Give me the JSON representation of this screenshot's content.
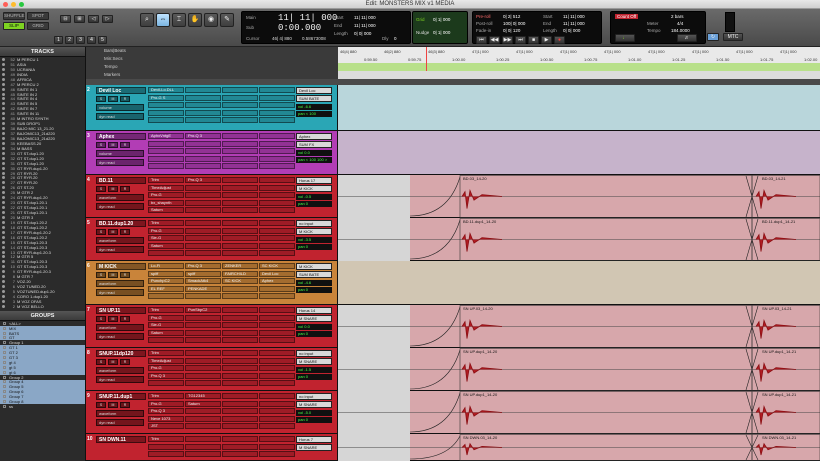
{
  "window": {
    "title": "Edit: MONSTERS MIX v1 MEDIA",
    "lights": [
      "#ff5f57",
      "#febc2e",
      "#28c840"
    ]
  },
  "toolbar": {
    "modes": [
      "SHUFFLE",
      "SPOT",
      "SLIP",
      "GRID"
    ],
    "presets": [
      "1",
      "2",
      "3",
      "4",
      "5"
    ],
    "tools": [
      {
        "icon": "zoom-icon",
        "glyph": "⌕",
        "on": false
      },
      {
        "icon": "trim-icon",
        "glyph": "⇔",
        "on": true
      },
      {
        "icon": "selector-icon",
        "glyph": "⌶",
        "on": false
      },
      {
        "icon": "grabber-icon",
        "glyph": "✋",
        "on": false
      },
      {
        "icon": "scrubber-icon",
        "glyph": "◉",
        "on": false
      },
      {
        "icon": "pencil-icon",
        "glyph": "✎",
        "on": false
      }
    ],
    "counter": {
      "main_label": "Main",
      "main": "11| 11| 000",
      "sub_label": "Sub",
      "sub": "0:00.000",
      "start_label": "Start",
      "start": "11| 11| 000",
      "end_label": "End",
      "end": "11| 11| 000",
      "length_label": "Length",
      "length": "0| 0| 000",
      "cursor_label": "Cursor",
      "cursor": "46| 4| 880",
      "sample": "0.58673008",
      "dly_label": "Dly",
      "dly": "0"
    },
    "grid": {
      "grid_label": "Grid",
      "grid_val": "0| 1| 000",
      "nudge_label": "Nudge",
      "nudge_val": "0| 1| 000"
    },
    "preroll": {
      "pre_label": "Pre-roll",
      "pre": "0| 2| 512",
      "post_label": "Post-roll",
      "post": "100| 0| 000",
      "fade_label": "Fade-in",
      "fade": "0| 0| 120"
    },
    "selection": {
      "start_label": "Start",
      "start": "11| 11| 000",
      "end_label": "End",
      "end": "11| 11| 000",
      "len_label": "Length",
      "len": "0| 0| 000"
    },
    "meter": {
      "count_off": "Count Off",
      "bars": "2 bars",
      "meter_label": "Meter",
      "meter": "4/4",
      "tempo_label": "Tempo",
      "tempo": "184.0000"
    },
    "transport_glyphs": [
      "⏮",
      "◀◀",
      "▶▶",
      "⏭",
      "■",
      "▶",
      "●"
    ],
    "mtc": "MTC"
  },
  "tracks_panel": {
    "header": "TRACKS",
    "items": [
      {
        "n": "52",
        "name": "M PERCU 1"
      },
      {
        "n": "51",
        "name": "ASIA"
      },
      {
        "n": "50",
        "name": "UCRANIA"
      },
      {
        "n": "49",
        "name": "INDIA"
      },
      {
        "n": "48",
        "name": "AFRICA"
      },
      {
        "n": "47",
        "name": "M PERCU 2"
      },
      {
        "n": "46",
        "name": "SINTE IN 1"
      },
      {
        "n": "45",
        "name": "SINTE IN 2"
      },
      {
        "n": "44",
        "name": "SINTE IN 4"
      },
      {
        "n": "43",
        "name": "SINTE IN 5"
      },
      {
        "n": "42",
        "name": "SINTE IN 7"
      },
      {
        "n": "41",
        "name": "SINTE IN 11"
      },
      {
        "n": "40",
        "name": "M INTRO SYNTH"
      },
      {
        "n": "39",
        "name": "SUB DROP1"
      },
      {
        "n": "38",
        "name": "BAJO MIC 13_21.20"
      },
      {
        "n": "37",
        "name": "BAJOMIC13_21d220"
      },
      {
        "n": "36",
        "name": "BAJOMIC13_21d220"
      },
      {
        "n": "35",
        "name": "KEEBASS.20"
      },
      {
        "n": "34",
        "name": "M BASS"
      },
      {
        "n": "33",
        "name": "GT ST.dup1.20"
      },
      {
        "n": "32",
        "name": "GT ST.dup1.20"
      },
      {
        "n": "31",
        "name": "GT ST.dup1.20"
      },
      {
        "n": "30",
        "name": "GT RYR.dup1.20"
      },
      {
        "n": "29",
        "name": "GT RYR.20"
      },
      {
        "n": "28",
        "name": "GT RYR.20"
      },
      {
        "n": "27",
        "name": "GT RYR.20"
      },
      {
        "n": "26",
        "name": "GT ST.20"
      },
      {
        "n": "25",
        "name": "M GTR 2"
      },
      {
        "n": "24",
        "name": "GT RYR.dup1.20"
      },
      {
        "n": "23",
        "name": "GT ST.dup1.20.1"
      },
      {
        "n": "22",
        "name": "GT ST.dup1.20.1"
      },
      {
        "n": "21",
        "name": "GT ST.dup1.20.1"
      },
      {
        "n": "20",
        "name": "M GTR 3"
      },
      {
        "n": "19",
        "name": "GT ST.dup1.20.2"
      },
      {
        "n": "18",
        "name": "GT ST.dup1.20.2"
      },
      {
        "n": "17",
        "name": "GT RYR.dup1.20.2"
      },
      {
        "n": "16",
        "name": "GT ST.dup1.20.2"
      },
      {
        "n": "15",
        "name": "GT ST.dup1.20.3"
      },
      {
        "n": "14",
        "name": "GT ST.dup1.20.3"
      },
      {
        "n": "13",
        "name": "GT RYR.dup1.20.3"
      },
      {
        "n": "12",
        "name": "M GTR 5"
      },
      {
        "n": "11",
        "name": "GT ST.dup1.20.3"
      },
      {
        "n": "10",
        "name": "GT ST.dup1.20.3"
      },
      {
        "n": "9",
        "name": "GT RYR.dup1.20.3"
      },
      {
        "n": "8",
        "name": "M GTR 7"
      },
      {
        "n": "7",
        "name": "VOZ.20"
      },
      {
        "n": "6",
        "name": "VOZ TUNED.20"
      },
      {
        "n": "5",
        "name": "VOZTUNED.dup1.20"
      },
      {
        "n": "4",
        "name": "CORO 1.dup1.20"
      },
      {
        "n": "3",
        "name": "M VOZ OFAS"
      },
      {
        "n": "2",
        "name": "M VOZ BELLO"
      }
    ]
  },
  "groups_panel": {
    "header": "GROUPS",
    "items": [
      {
        "name": "<ALL>",
        "sel": false
      },
      {
        "name": "MIX",
        "sel": true
      },
      {
        "name": "BATS",
        "sel": true
      },
      {
        "name": "GT",
        "sel": true
      },
      {
        "name": "Group 1",
        "sel": false
      },
      {
        "name": "GT 1",
        "sel": true
      },
      {
        "name": "GT 2",
        "sel": true
      },
      {
        "name": "GT 3",
        "sel": true
      },
      {
        "name": "gt 4",
        "sel": true
      },
      {
        "name": "gt 5",
        "sel": true
      },
      {
        "name": "gt 6",
        "sel": true
      },
      {
        "name": "Group 2",
        "sel": false
      },
      {
        "name": "Group 4",
        "sel": true
      },
      {
        "name": "Group 5",
        "sel": true
      },
      {
        "name": "Group 6",
        "sel": true
      },
      {
        "name": "Group 7",
        "sel": true
      },
      {
        "name": "Group 8",
        "sel": true
      },
      {
        "name": "ss",
        "sel": false
      }
    ]
  },
  "columns": {
    "ruler_name": "Bars|Beats",
    "inserts_ae": "INSERTS A-E",
    "inserts_fj": "INSERTS F-J",
    "sends_ae": "SENDS A-E",
    "sends_fj": "SENDS F-J",
    "io": "I / O",
    "rows": [
      "Min:Secs",
      "Tempo",
      "Markers"
    ],
    "bars": [
      "46|4| 880",
      "46|2| 880",
      "46|3| 880",
      "47|1| 000",
      "47|1| 000",
      "47|1| 000",
      "47|1| 000",
      "47|1| 000",
      "47|1| 000",
      "47|1| 000",
      "47|1| 000"
    ],
    "times": [
      "0:59.50",
      "0:59.75",
      "1:00.00",
      "1:00.25",
      "1:00.50",
      "1:00.75",
      "1:01.00",
      "1:01.25",
      "1:01.50",
      "1:01.75",
      "1:02.00"
    ]
  },
  "tracks": [
    {
      "num": "2",
      "name": "Devil Loc",
      "color": "#2aa6b5",
      "lane": "#b9d6db",
      "height": 46,
      "view": "volume",
      "inserts": [
        "Devil-Lo.DLL",
        "Pro-G S"
      ],
      "inserts_fj": [],
      "sends": [],
      "sends_fj": [],
      "io": [
        "Devil Loc",
        "SUM BATE"
      ],
      "vol": "-6.6",
      "pan": "< 100",
      "clips": []
    },
    {
      "num": "3",
      "name": "Aphex",
      "color": "#b23db5",
      "lane": "#c6b3cb",
      "height": 44,
      "view": "volume",
      "inserts": [
        "AphxVntgE"
      ],
      "inserts_fj": [
        "Pro-Q 3"
      ],
      "sends": [],
      "sends_fj": [],
      "io": [
        "Aphex",
        "SUM FX"
      ],
      "vol": "0.0",
      "pan": "< 100  100 >",
      "clips": []
    },
    {
      "num": "4",
      "name": "BD.11",
      "color": "#c1232f",
      "lane": "#d7a7ab",
      "height": 43,
      "view": "waveform",
      "inserts": [
        "Trim",
        "TimeAdjust",
        "Pro-G",
        "bx_shaynth",
        "Saturn"
      ],
      "inserts_fj": [
        "Pro-Q 3"
      ],
      "sends": [],
      "sends_fj": [],
      "io": [
        "Horus 17",
        "M KICK"
      ],
      "vol": "-0.5",
      "pan": "0",
      "clips": [
        "BD.03_14-20",
        "BD.03_14-21"
      ]
    },
    {
      "num": "5",
      "name": "BD.11.dup1.20",
      "color": "#c1232f",
      "lane": "#d7a7ab",
      "height": 43,
      "view": "waveform",
      "inserts": [
        "Trim",
        "Pro-G",
        "Sie-G",
        "Saturn"
      ],
      "inserts_fj": [],
      "sends": [],
      "sends_fj": [],
      "io": [
        "no input",
        "M KICK"
      ],
      "vol": "-3.5",
      "pan": "0",
      "clips": [
        "BD.11.dup1_14-20",
        "BD.11.dup1_14-21"
      ]
    },
    {
      "num": "6",
      "name": "M KICK",
      "color": "#c9843a",
      "lane": "#d1c6b3",
      "height": 44,
      "view": "waveform",
      "inserts": [
        "Lo-Fi",
        "spiff",
        "PunchpC2",
        "EL REF"
      ],
      "inserts_fj": [
        "Pro-Q 3",
        "spiff",
        "SmackAtk4",
        "PENKADE"
      ],
      "sends": [
        "ZENKER",
        "FAIRCHILD",
        "SC KICK"
      ],
      "sends_fj": [
        "SC KICK",
        "Devil Loc",
        "Aphex"
      ],
      "io": [
        "M KICK",
        "SUM BATE"
      ],
      "vol": "-4.6",
      "pan": "0",
      "clips": []
    },
    {
      "num": "7",
      "name": "SN UP.11",
      "color": "#c1232f",
      "lane": "#d7a7ab",
      "height": 43,
      "view": "waveform",
      "inserts": [
        "Trim",
        "Pro-G",
        "Sie-G",
        "Saturn"
      ],
      "inserts_fj": [
        "PunSbpC2"
      ],
      "sends": [],
      "sends_fj": [],
      "io": [
        "Horus 14",
        "M SNARE"
      ],
      "vol": "0.0",
      "pan": "0",
      "clips": [
        "SN UP.03_14-20",
        "SN UP.03_14-21"
      ]
    },
    {
      "num": "8",
      "name": "SNUP.11dp120",
      "color": "#c1232f",
      "lane": "#d7a7ab",
      "height": 43,
      "view": "waveform",
      "inserts": [
        "Trim",
        "TimeAdjust",
        "Pro-G",
        "Pro-Q 3"
      ],
      "inserts_fj": [],
      "sends": [],
      "sends_fj": [],
      "io": [
        "no input",
        "M SNARE"
      ],
      "vol": "-1.5",
      "pan": "0",
      "clips": [
        "SN UP.dup1_14-20",
        "SN UP.dup1_14-21"
      ]
    },
    {
      "num": "9",
      "name": "SNUP.11.dup1",
      "color": "#c1232f",
      "lane": "#d7a7ab",
      "height": 43,
      "view": "waveform",
      "inserts": [
        "Trim",
        "Pro-G",
        "Pro-Q 3",
        "Neve 1073",
        "JST"
      ],
      "inserts_fj": [
        "TG12345",
        "Saturn"
      ],
      "sends": [],
      "sends_fj": [],
      "io": [
        "no input",
        "M SNARE"
      ],
      "vol": "-5.0",
      "pan": "0",
      "clips": [
        "SN UP.dup1_14-20",
        "SN UP.dup1_14-21"
      ]
    },
    {
      "num": "10",
      "name": "SN DWN.11",
      "color": "#c1232f",
      "lane": "#d7a7ab",
      "height": 27,
      "view": "waveform",
      "inserts": [
        "Trim"
      ],
      "inserts_fj": [],
      "sends": [],
      "sends_fj": [],
      "io": [
        "Horus 7",
        "M SNARE"
      ],
      "vol": "",
      "pan": "",
      "clips": [
        "SN DWN.03_14-20",
        "SN DWN.03_14-21"
      ]
    }
  ]
}
